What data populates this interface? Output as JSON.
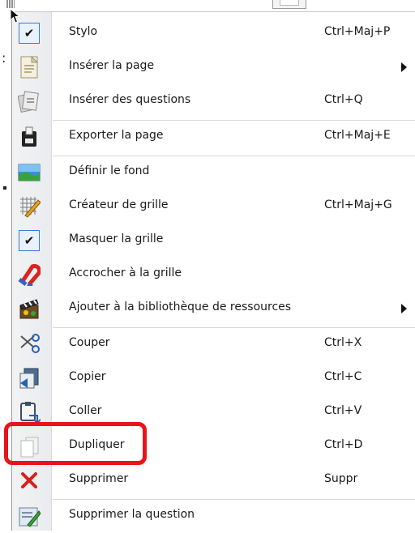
{
  "background": {
    "colon": ":"
  },
  "menu": {
    "items": [
      {
        "label": "Stylo",
        "shortcut": "Ctrl+Maj+P",
        "icon": "checkmark-icon",
        "checked": true
      },
      {
        "label": "Insérer la page",
        "shortcut": "",
        "icon": "insert-page-icon",
        "submenu": true
      },
      {
        "label": "Insérer des questions",
        "shortcut": "Ctrl+Q",
        "icon": "insert-questions-icon"
      },
      {
        "label": "Exporter la page",
        "shortcut": "Ctrl+Maj+E",
        "icon": "export-page-icon"
      },
      {
        "label": "Définir le fond",
        "shortcut": "",
        "icon": "background-image-icon"
      },
      {
        "label": "Créateur de grille",
        "shortcut": "Ctrl+Maj+G",
        "icon": "grid-creator-icon"
      },
      {
        "label": "Masquer la grille",
        "shortcut": "",
        "icon": "checkmark-icon",
        "checked": true
      },
      {
        "label": "Accrocher à la grille",
        "shortcut": "",
        "icon": "magnet-icon"
      },
      {
        "label": "Ajouter à la bibliothèque de ressources",
        "shortcut": "",
        "icon": "film-clapper-icon",
        "submenu": true
      },
      {
        "label": "Couper",
        "shortcut": "Ctrl+X",
        "icon": "scissors-icon"
      },
      {
        "label": "Copier",
        "shortcut": "Ctrl+C",
        "icon": "copy-icon"
      },
      {
        "label": "Coller",
        "shortcut": "Ctrl+V",
        "icon": "paste-icon"
      },
      {
        "label": "Dupliquer",
        "shortcut": "Ctrl+D",
        "icon": "duplicate-icon",
        "highlighted": true
      },
      {
        "label": "Supprimer",
        "shortcut": "Suppr",
        "icon": "delete-x-icon"
      },
      {
        "label": "Supprimer la question",
        "shortcut": "",
        "icon": "delete-question-icon"
      }
    ]
  },
  "colors": {
    "highlight": "#e8131b",
    "check_border": "#3b7ad8",
    "delete_red": "#d91e1e"
  }
}
